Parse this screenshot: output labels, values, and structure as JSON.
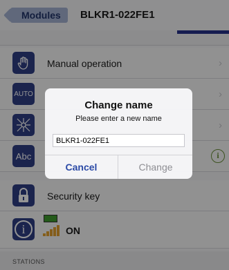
{
  "nav": {
    "back_label": "Modules",
    "title": "BLKR1-022FE1"
  },
  "rows": [
    {
      "label": "Manual operation",
      "icon_text": ""
    },
    {
      "label": "",
      "icon_text": "AUTO"
    },
    {
      "label": "",
      "icon_text": ""
    },
    {
      "label": "",
      "icon_text": "Abc"
    },
    {
      "label": "Security key",
      "icon_text": ""
    },
    {
      "label": "ON",
      "icon_text": "i"
    }
  ],
  "section": {
    "label": "STATIONS"
  },
  "dialog": {
    "title": "Change name",
    "message": "Please enter a new name",
    "input_value": "BLKR1-022FE1",
    "cancel_label": "Cancel",
    "change_label": "Change"
  },
  "colors": {
    "accent": "#2f3e86",
    "progress": "#27318a",
    "cancel": "#2b4aa6",
    "info": "#6b8f3a"
  }
}
